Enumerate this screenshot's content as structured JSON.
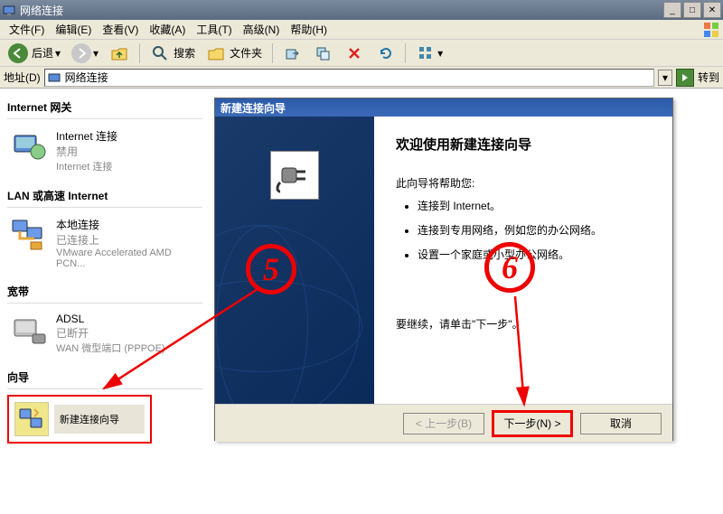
{
  "window": {
    "title": "网络连接"
  },
  "menu": {
    "file": "文件(F)",
    "edit": "编辑(E)",
    "view": "查看(V)",
    "favorites": "收藏(A)",
    "tools": "工具(T)",
    "advanced": "高级(N)",
    "help": "帮助(H)"
  },
  "toolbar": {
    "back": "后退",
    "search": "搜索",
    "folders": "文件夹"
  },
  "address": {
    "label": "地址(D)",
    "value": "网络连接",
    "go": "转到"
  },
  "sections": {
    "internet_gateway": "Internet 网关",
    "lan": "LAN 或高速 Internet",
    "broadband": "宽带",
    "wizard": "向导"
  },
  "items": {
    "internet_conn": {
      "name": "Internet 连接",
      "status": "禁用",
      "detail": "Internet 连接"
    },
    "local_conn": {
      "name": "本地连接",
      "status": "已连接上",
      "detail": "VMware Accelerated AMD PCN..."
    },
    "adsl": {
      "name": "ADSL",
      "status": "已断开",
      "detail": "WAN 微型端口 (PPPOE)"
    },
    "new_wizard": {
      "name": "新建连接向导"
    }
  },
  "dialog": {
    "title": "新建连接向导",
    "heading": "欢迎使用新建连接向导",
    "intro": "此向导将帮助您:",
    "bullets": [
      "连接到 Internet。",
      "连接到专用网络，例如您的办公网络。",
      "设置一个家庭或小型办公网络。"
    ],
    "continue": "要继续，请单击\"下一步\"。",
    "btn_back": "< 上一步(B)",
    "btn_next": "下一步(N) >",
    "btn_cancel": "取消"
  },
  "annotations": {
    "five": "5",
    "six": "6"
  }
}
